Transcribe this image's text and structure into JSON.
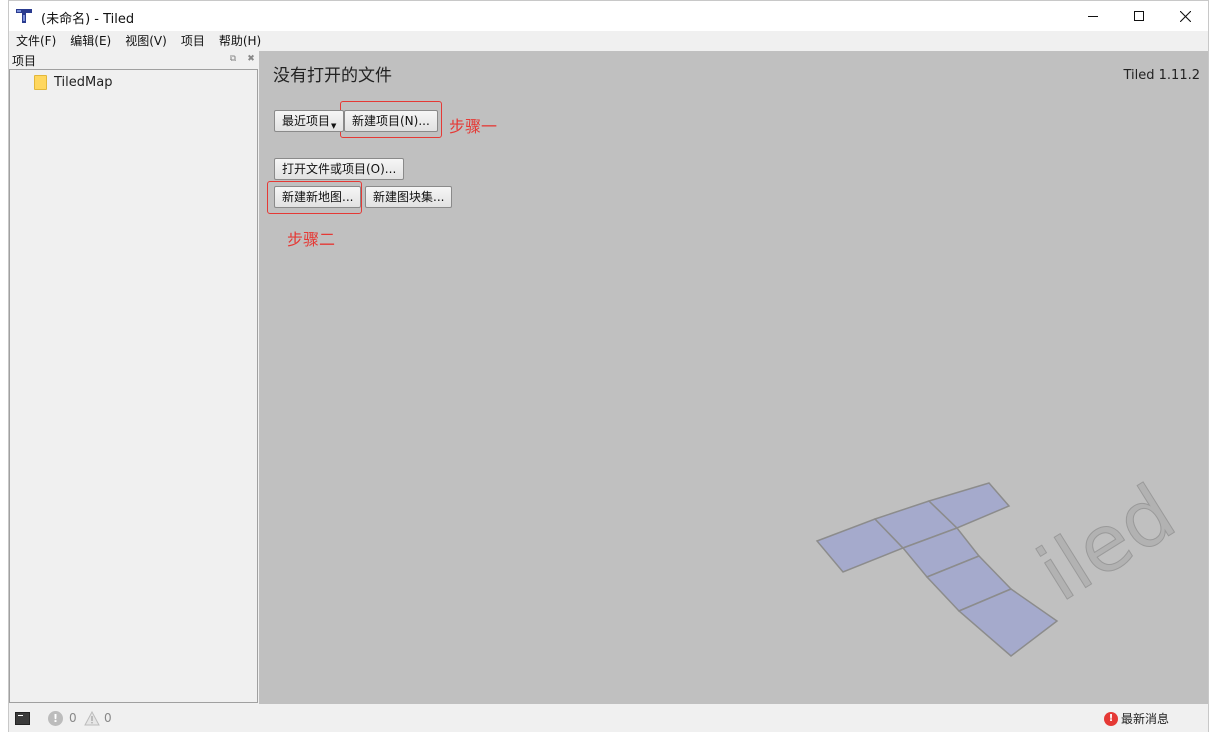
{
  "titlebar": {
    "title": "(未命名) - Tiled",
    "app_icon": "tiled-logo-icon",
    "minimize_icon": "minimize-icon",
    "maximize_icon": "maximize-icon",
    "close_icon": "close-icon"
  },
  "menubar": {
    "items": [
      {
        "label": "文件(F)"
      },
      {
        "label": "编辑(E)"
      },
      {
        "label": "视图(V)"
      },
      {
        "label": "项目"
      },
      {
        "label": "帮助(H)"
      }
    ]
  },
  "project_panel": {
    "title": "项目",
    "items": [
      {
        "label": "TiledMap",
        "icon": "folder-icon"
      }
    ]
  },
  "welcome": {
    "title": "没有打开的文件",
    "version": "Tiled 1.11.2",
    "recent_projects_label": "最近项目",
    "new_project_label": "新建项目(N)...",
    "open_file_label": "打开文件或项目(O)...",
    "new_map_label": "新建新地图...",
    "new_tileset_label": "新建图块集...",
    "watermark_text": "iled"
  },
  "annotations": {
    "step1": "步骤一",
    "step2": "步骤二",
    "highlight_color": "#e53935"
  },
  "statusbar": {
    "error_count": "0",
    "warning_count": "0",
    "news_label": "最新消息"
  },
  "colors": {
    "main_background": "#c0c0c0",
    "panel_background": "#f0f0f0"
  }
}
